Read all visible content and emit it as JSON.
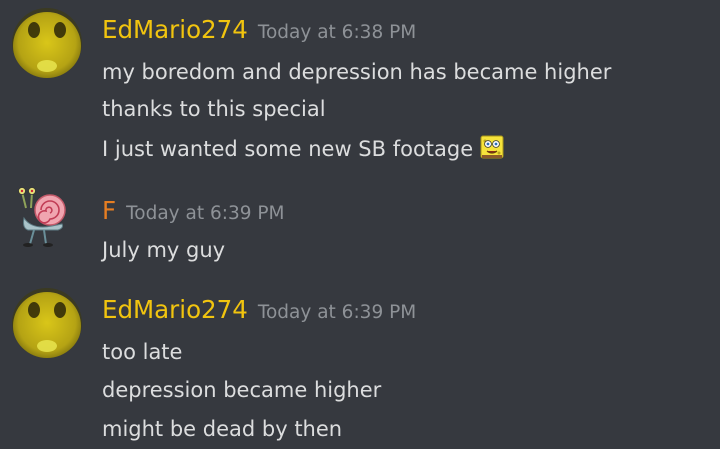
{
  "colors": {
    "background": "#36393f",
    "message_text": "#dcddde",
    "timestamp_text": "#8e9297",
    "username_edmario": "#f1c40f",
    "username_f": "#e67e22"
  },
  "messages": [
    {
      "author": "EdMario274",
      "timestamp": "Today at 6:38 PM",
      "avatar_icon": "yellow-face-avatar",
      "lines": [
        "my boredom and depression has became higher",
        "thanks to this special",
        "I just wanted some new SB footage"
      ],
      "emoji": "spongebob-emoji"
    },
    {
      "author": "F",
      "timestamp": "Today at 6:39 PM",
      "avatar_icon": "snail-avatar",
      "lines": [
        "July my guy"
      ]
    },
    {
      "author": "EdMario274",
      "timestamp": "Today at 6:39 PM",
      "avatar_icon": "yellow-face-avatar",
      "lines": [
        "too late",
        "depression became higher",
        "might be dead by then"
      ]
    }
  ]
}
